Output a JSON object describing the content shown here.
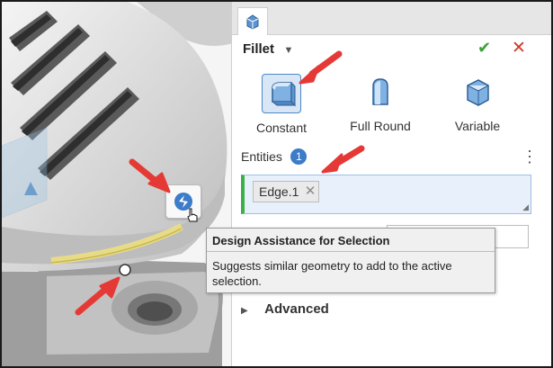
{
  "feature": {
    "icon": "fillet-feature-icon",
    "title": "Fillet",
    "ok_icon": "✔",
    "cancel_icon": "✕"
  },
  "fillet_types": [
    {
      "label": "Constant",
      "icon": "constant-fillet-icon",
      "selected": true
    },
    {
      "label": "Full Round",
      "icon": "full-round-fillet-icon",
      "selected": false
    },
    {
      "label": "Variable",
      "icon": "variable-fillet-icon",
      "selected": false
    }
  ],
  "entities": {
    "label": "Entities",
    "count": "1",
    "items": [
      {
        "name": "Edge.1",
        "remove": "✕"
      }
    ]
  },
  "advanced": {
    "label": "Advanced"
  },
  "tooltip": {
    "title": "Design Assistance for Selection",
    "body": "Suggests similar geometry to add to the active selection."
  },
  "colors": {
    "accent": "#3d7cc9",
    "ok": "#3aa13a",
    "cancel": "#d0392b",
    "annotation_arrow": "#e53935",
    "selection_bar": "#3bb04a"
  }
}
